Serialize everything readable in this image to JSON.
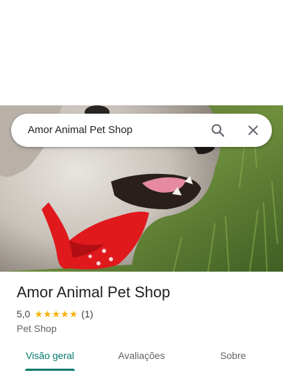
{
  "search": {
    "query": "Amor Animal Pet Shop",
    "search_icon": "search-icon",
    "close_icon": "close-icon"
  },
  "hero_image": {
    "subject": "dog-with-red-bow-photo"
  },
  "place": {
    "name": "Amor Animal Pet Shop",
    "rating": "5,0",
    "stars": 5,
    "star_glyph": "★",
    "review_count": "(1)",
    "category": "Pet Shop"
  },
  "tabs": [
    {
      "label": "Visão geral",
      "active": true
    },
    {
      "label": "Avaliações",
      "active": false
    },
    {
      "label": "Sobre",
      "active": false
    }
  ],
  "colors": {
    "accent": "#00796b",
    "star": "#f6b30a",
    "text_primary": "#202124",
    "text_secondary": "#5f6368"
  }
}
